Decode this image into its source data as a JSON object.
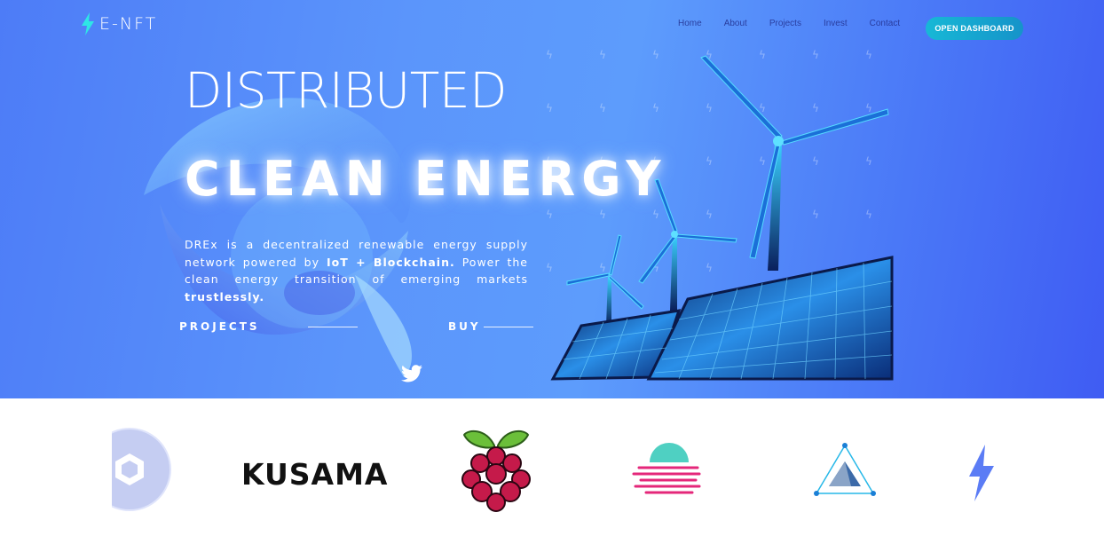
{
  "header": {
    "logo_text": "E-NFT",
    "nav": [
      "Home",
      "About",
      "Projects",
      "Invest",
      "Contact"
    ],
    "dashboard_button": "OPEN DASHBOARD"
  },
  "hero": {
    "title_line1": "DISTRIBUTED",
    "title_line2": "CLEAN ENERGY",
    "description": {
      "part1": "DREx is a decentralized renewable energy supply network powered by ",
      "bold1": "IoT + Blockchain.",
      "part2": " Power the clean energy transition of emerging markets ",
      "bold2": "trustlessly."
    },
    "cta_projects": "PROJECTS",
    "cta_buy": "BUY"
  },
  "partners": {
    "kusama_text": "KUSAMA"
  },
  "colors": {
    "hero_gradient_start": "#4d7cf7",
    "hero_gradient_end": "#3f5cf3",
    "button_start": "#17b8d6",
    "button_end": "#1693c9",
    "accent_bolt": "#5b7cf5"
  }
}
